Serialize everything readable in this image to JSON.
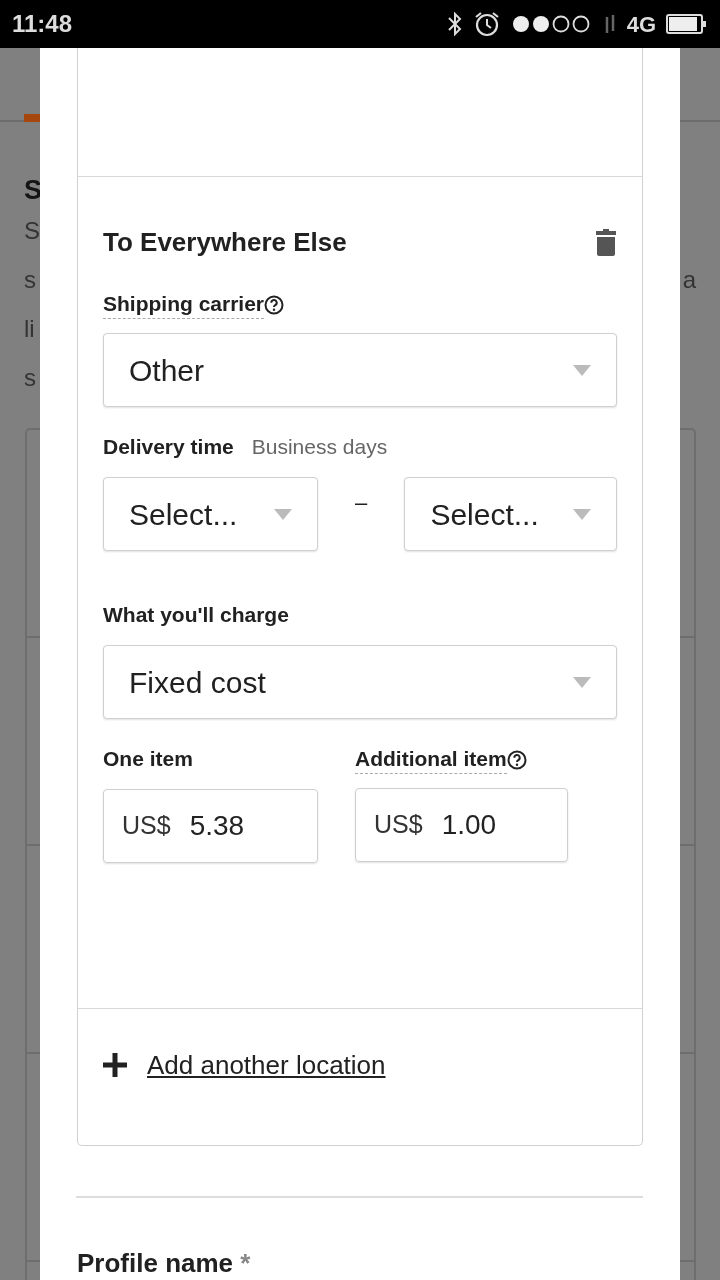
{
  "status_bar": {
    "time": "11:48",
    "network": "4G"
  },
  "background": {
    "tab": {
      "selected": true
    },
    "heading": "S",
    "lines": [
      {
        "left": "S"
      },
      {
        "left": "s",
        "right": "a"
      },
      {
        "left": "li"
      },
      {
        "left": "s"
      }
    ]
  },
  "section": {
    "title": "To Everywhere Else",
    "carrier": {
      "label": "Shipping carrier",
      "value": "Other"
    },
    "delivery": {
      "label": "Delivery time",
      "hint": "Business days",
      "from": "Select...",
      "separator": "–",
      "to": "Select..."
    },
    "charge": {
      "label": "What you'll charge",
      "value": "Fixed cost"
    },
    "one_item": {
      "label": "One item",
      "currency": "US$",
      "value": "5.38"
    },
    "additional_item": {
      "label": "Additional item",
      "currency": "US$",
      "value": "1.00"
    }
  },
  "add_location": {
    "label": "Add another location"
  },
  "profile": {
    "label": "Profile name",
    "required_mark": "*"
  }
}
